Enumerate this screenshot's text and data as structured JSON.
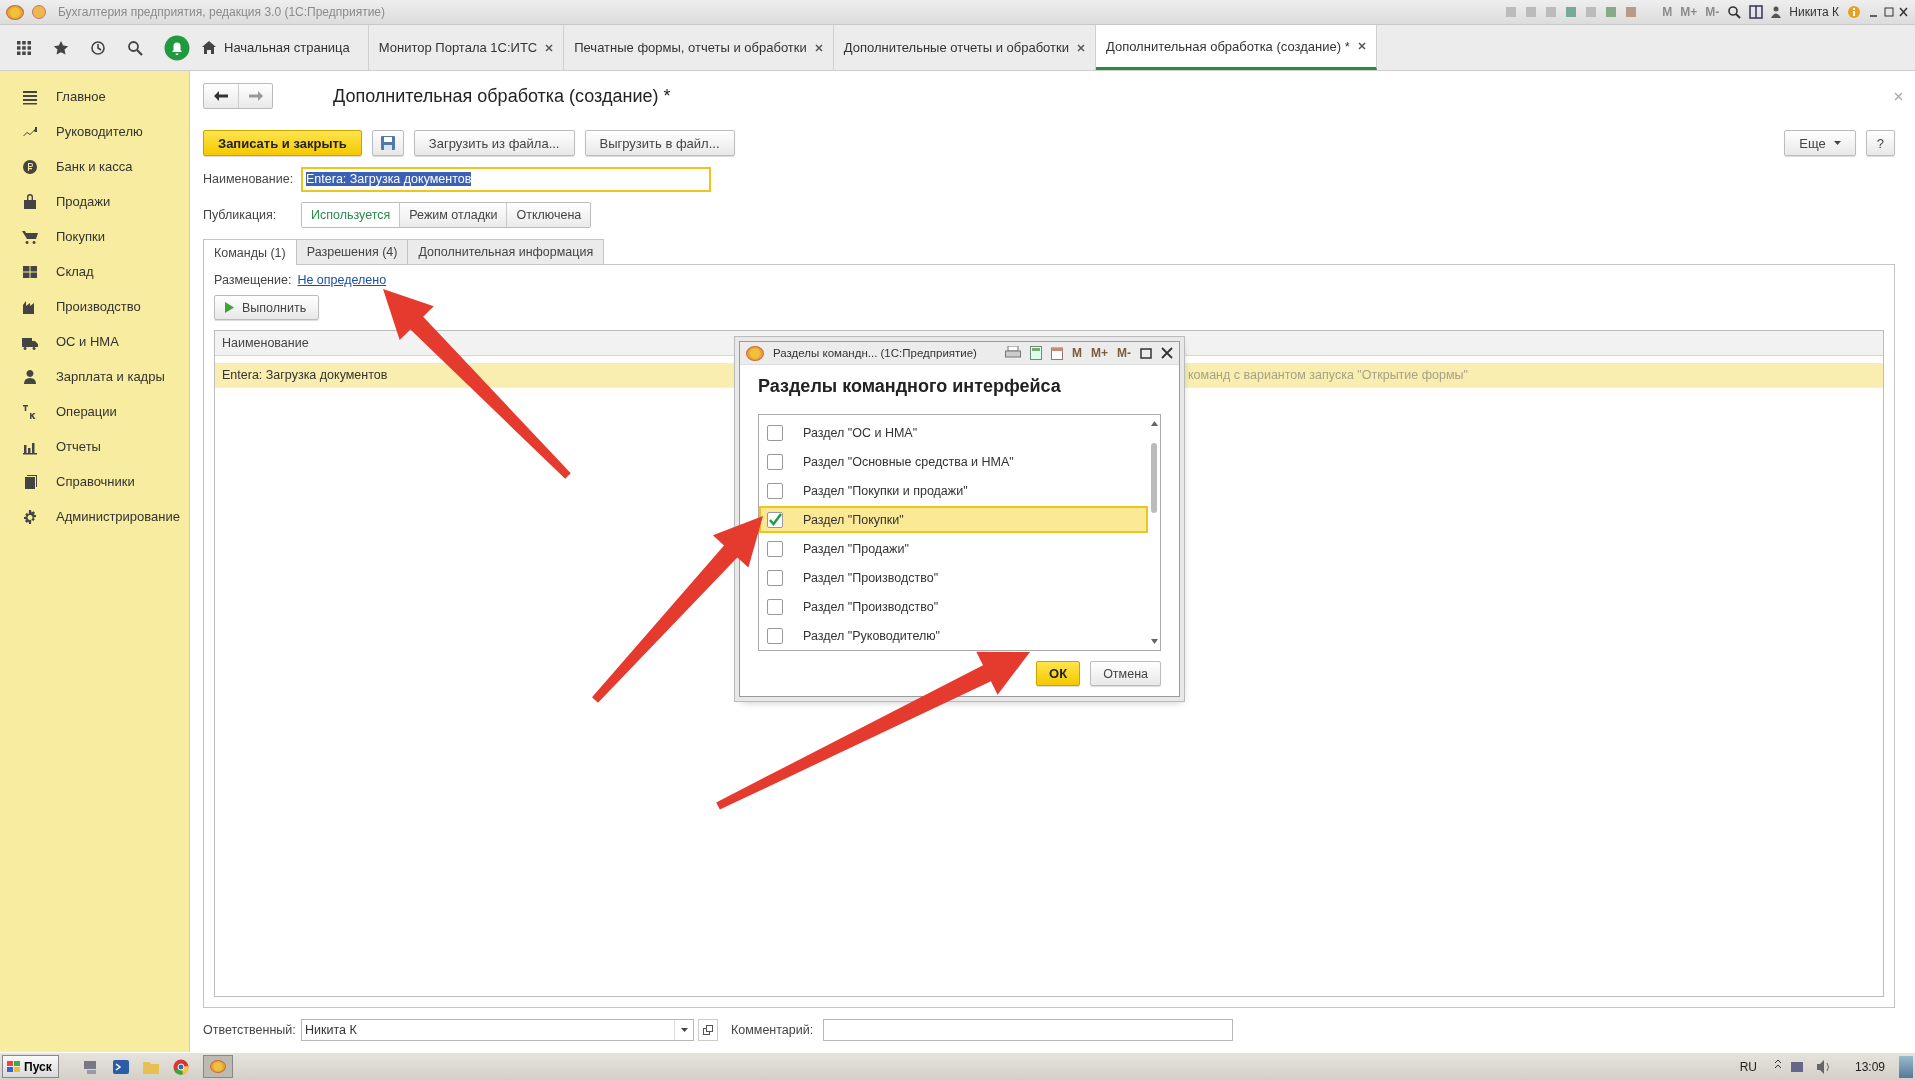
{
  "title_bar": {
    "title": "Бухгалтерия предприятия, редакция 3.0  (1С:Предприятие)",
    "calc_buttons": [
      "M",
      "M+",
      "M-"
    ],
    "user": "Никита К"
  },
  "home_tab": "Начальная страница",
  "tabs": [
    {
      "label": "Монитор Портала 1С:ИТС",
      "selected": false
    },
    {
      "label": "Печатные формы, отчеты и обработки",
      "selected": false
    },
    {
      "label": "Дополнительные отчеты и обработки",
      "selected": false
    },
    {
      "label": "Дополнительная обработка (создание) *",
      "selected": true
    }
  ],
  "sidebar": {
    "items": [
      {
        "label": "Главное"
      },
      {
        "label": "Руководителю"
      },
      {
        "label": "Банк и касса"
      },
      {
        "label": "Продажи"
      },
      {
        "label": "Покупки"
      },
      {
        "label": "Склад"
      },
      {
        "label": "Производство"
      },
      {
        "label": "ОС и НМА"
      },
      {
        "label": "Зарплата и кадры"
      },
      {
        "label": "Операции"
      },
      {
        "label": "Отчеты"
      },
      {
        "label": "Справочники"
      },
      {
        "label": "Администрирование"
      }
    ]
  },
  "form": {
    "title": "Дополнительная обработка (создание) *",
    "buttons": {
      "save_close": "Записать и закрыть",
      "load": "Загрузить из файла...",
      "unload": "Выгрузить в файл...",
      "more": "Еще",
      "help": "?"
    },
    "name_label": "Наименование:",
    "name_value": "Entera: Загрузка документов",
    "publication_label": "Публикация:",
    "publication_options": [
      {
        "label": "Используется",
        "selected": true
      },
      {
        "label": "Режим отладки",
        "selected": false
      },
      {
        "label": "Отключена",
        "selected": false
      }
    ],
    "tabs": [
      {
        "label": "Команды (1)",
        "selected": true
      },
      {
        "label": "Разрешения (4)",
        "selected": false
      },
      {
        "label": "Дополнительная информация",
        "selected": false
      }
    ],
    "placement_label": "Размещение:",
    "placement_link": "Не определено",
    "run_button": "Выполнить",
    "table": {
      "columns": [
        "Наименование"
      ],
      "rows": [
        {
          "cells": [
            "Entera: Загрузка документов",
            "команд с вариантом запуска \"Открытие формы\""
          ],
          "selected": true
        }
      ]
    },
    "responsible_label": "Ответственный:",
    "responsible_value": "Никита К",
    "comment_label": "Комментарий:"
  },
  "dialog": {
    "title": "Разделы командн...  (1С:Предприятие)",
    "calc_buttons": [
      "M",
      "M+",
      "M-"
    ],
    "heading": "Разделы командного интерфейса",
    "items": [
      {
        "label": "Раздел \"ОС и НМА\"",
        "checked": false,
        "selected": false
      },
      {
        "label": "Раздел \"Основные средства и НМА\"",
        "checked": false,
        "selected": false
      },
      {
        "label": "Раздел \"Покупки и продажи\"",
        "checked": false,
        "selected": false
      },
      {
        "label": "Раздел \"Покупки\"",
        "checked": true,
        "selected": true
      },
      {
        "label": "Раздел \"Продажи\"",
        "checked": false,
        "selected": false
      },
      {
        "label": "Раздел \"Производство\"",
        "checked": false,
        "selected": false
      },
      {
        "label": "Раздел \"Производство\"",
        "checked": false,
        "selected": false
      },
      {
        "label": "Раздел \"Руководителю\"",
        "checked": false,
        "selected": false
      }
    ],
    "ok": "ОК",
    "cancel": "Отмена"
  },
  "taskbar": {
    "start": "Пуск",
    "language": "RU",
    "time": "13:09"
  }
}
